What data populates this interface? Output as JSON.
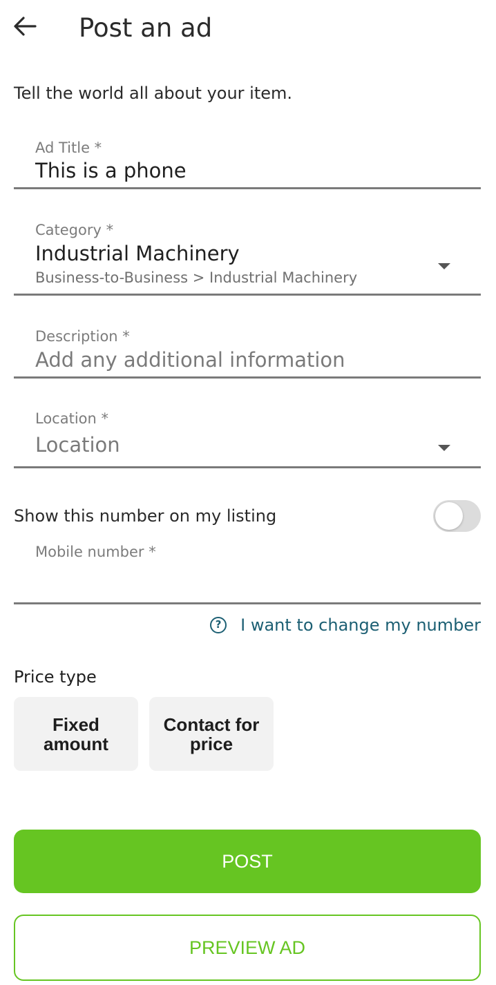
{
  "header": {
    "back_icon": "arrow-left-icon",
    "title": "Post an ad"
  },
  "intro_text": "Tell the world all about your item.",
  "form": {
    "ad_title": {
      "label": "Ad Title *",
      "value": "This is a phone"
    },
    "category": {
      "label": "Category *",
      "value": "Industrial Machinery",
      "path": "Business-to-Business > Industrial Machinery",
      "dropdown_icon": "caret-down-icon"
    },
    "description": {
      "label": "Description *",
      "placeholder": "Add any additional information",
      "value": ""
    },
    "location": {
      "label": "Location *",
      "placeholder": "Location",
      "dropdown_icon": "caret-down-icon"
    },
    "show_number": {
      "label": "Show this number on my listing",
      "enabled": false
    },
    "mobile_number": {
      "label": "Mobile number *",
      "value": ""
    },
    "change_number": {
      "icon": "help-circle-icon",
      "label": "I want to change my number"
    },
    "price_type": {
      "label": "Price type",
      "options": [
        "Fixed amount",
        "Contact for price"
      ]
    }
  },
  "actions": {
    "post_label": "POST",
    "preview_label": "PREVIEW AD"
  },
  "colors": {
    "accent_green": "#66c522",
    "link_teal": "#1c5f73",
    "option_bg": "#f2f2f2",
    "underline_gray": "#7a7a7a"
  }
}
